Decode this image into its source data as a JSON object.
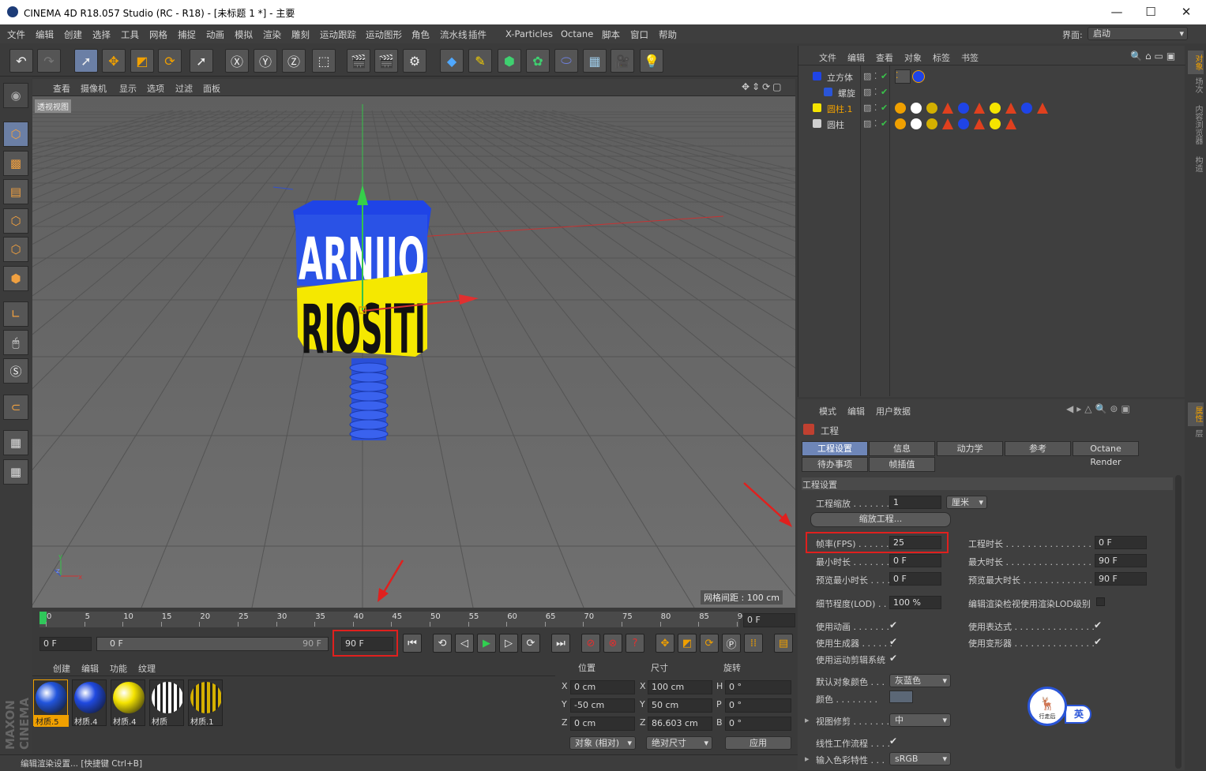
{
  "window": {
    "title": "CINEMA 4D R18.057 Studio (RC - R18) - [未标题 1 *] - 主要",
    "min": "—",
    "max": "☐",
    "close": "✕"
  },
  "menu": [
    "文件",
    "编辑",
    "创建",
    "选择",
    "工具",
    "网格",
    "捕捉",
    "动画",
    "模拟",
    "渲染",
    "雕刻",
    "运动跟踪",
    "运动图形",
    "角色",
    "流水线",
    "插件",
    "X-Particles",
    "Octane",
    "脚本",
    "窗口",
    "帮助"
  ],
  "layout": {
    "label": "界面:",
    "value": "启动"
  },
  "viewport": {
    "menu": [
      "查看",
      "摄像机",
      "显示",
      "选项",
      "过滤",
      "面板"
    ],
    "name": "透视视图",
    "grid_spacing": "网格间距 : 100 cm",
    "text_top": "ARNIIO",
    "text_bottom": "RIOSITI"
  },
  "timeline": {
    "ticks": [
      "0",
      "5",
      "10",
      "15",
      "20",
      "25",
      "30",
      "35",
      "40",
      "45",
      "50",
      "55",
      "60",
      "65",
      "70",
      "75",
      "80",
      "85",
      "90"
    ],
    "current": "0 F",
    "start": "0 F",
    "range_start": "0 F",
    "range_end": "90 F",
    "end": "90 F"
  },
  "material_manager": {
    "menu": [
      "创建",
      "编辑",
      "功能",
      "纹理"
    ],
    "materials": [
      {
        "name": "材质.5",
        "color": "#2255dd"
      },
      {
        "name": "材质.4",
        "color": "#1f49e0"
      },
      {
        "name": "材质.4",
        "color": "#f5e400"
      },
      {
        "name": "材质",
        "color": "#ffffff"
      },
      {
        "name": "材质.1",
        "color": "#d4b000"
      }
    ]
  },
  "coords": {
    "headers": [
      "位置",
      "尺寸",
      "旋转"
    ],
    "rows": [
      {
        "axis": "X",
        "pos": "0 cm",
        "size_axis": "X",
        "size": "100 cm",
        "rot_axis": "H",
        "rot": "0 °"
      },
      {
        "axis": "Y",
        "pos": "-50 cm",
        "size_axis": "Y",
        "size": "50 cm",
        "rot_axis": "P",
        "rot": "0 °"
      },
      {
        "axis": "Z",
        "pos": "0 cm",
        "size_axis": "Z",
        "size": "86.603 cm",
        "rot_axis": "B",
        "rot": "0 °"
      }
    ],
    "mode1": "对象 (相对)",
    "mode2": "绝对尺寸",
    "apply": "应用"
  },
  "object_manager": {
    "menu": [
      "文件",
      "编辑",
      "查看",
      "对象",
      "标签",
      "书签"
    ],
    "objects": [
      {
        "name": "立方体",
        "active": false
      },
      {
        "name": "螺旋",
        "active": false
      },
      {
        "name": "圆柱.1",
        "active": true
      },
      {
        "name": "圆柱",
        "active": false
      }
    ]
  },
  "attributes": {
    "menu": [
      "模式",
      "编辑",
      "用户数据"
    ],
    "title": "工程",
    "tabs_row1": [
      "工程设置",
      "信息",
      "动力学",
      "参考",
      "Octane Render"
    ],
    "tabs_row2": [
      "待办事项",
      "帧插值"
    ],
    "section": "工程设置",
    "scale_label": "工程缩放 . . . . . . .",
    "scale_value": "1",
    "scale_unit": "厘米",
    "scale_button": "缩放工程...",
    "fps_label": "帧率(FPS) . . . . . .",
    "fps_value": "25",
    "duration_label": "工程时长 . . . . . . . . . . . . . . . .",
    "duration_value": "0 F",
    "min_label": "最小时长 . . . . . . .",
    "min_value": "0 F",
    "max_label": "最大时长 . . . . . . . . . . . . . . . .",
    "max_value": "90 F",
    "pmin_label": "预览最小时长 . . . .",
    "pmin_value": "0 F",
    "pmax_label": "预览最大时长 . . . . . . . . . . . . .",
    "pmax_value": "90 F",
    "lod_label": "细节程度(LOD) . . .",
    "lod_value": "100 %",
    "lod_render_label": "编辑渲染检视使用渲染LOD级别",
    "use_anim": "使用动画 . . . . . . .",
    "use_expr": "使用表达式 . . . . . . . . . . . . . . .",
    "use_gen": "使用生成器 . . . . . .",
    "use_deform": "使用变形器 . . . . . . . . . . . . . . .",
    "use_motion": "使用运动剪辑系统",
    "default_color_label": "默认对象颜色 . . .",
    "default_color_value": "灰蓝色",
    "color_label": "颜色 . . . . . . . .",
    "clip_label": "视图修剪 . . . . . . .",
    "clip_value": "中",
    "linear_label": "线性工作流程 . . . .",
    "input_color_label": "输入色彩特性 . . .",
    "input_color_value": "sRGB"
  },
  "right_tabs": [
    "对象",
    "场次",
    "内容浏览器",
    "构造",
    "属性",
    "层"
  ],
  "status": "编辑渲染设置... [快捷键 Ctrl+B]",
  "badge": {
    "ime": "英",
    "logo": "行走后"
  }
}
